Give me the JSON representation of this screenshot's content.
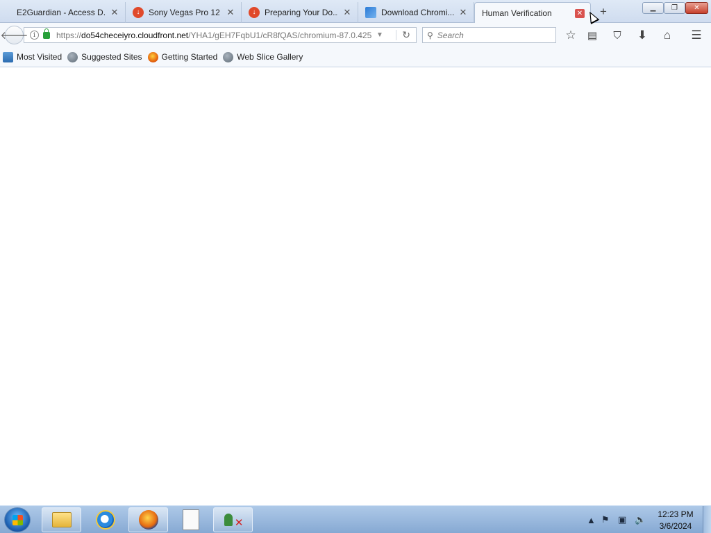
{
  "browser": {
    "tabs": [
      {
        "label": "E2Guardian - Access D...",
        "favicon": "none",
        "active": false
      },
      {
        "label": "Sony Vegas Pro 12 ...",
        "favicon": "download-icon",
        "active": false
      },
      {
        "label": "Preparing Your Do...",
        "favicon": "download-icon",
        "active": false
      },
      {
        "label": "Download Chromi...",
        "favicon": "chromium-icon",
        "active": false
      },
      {
        "label": "Human Verification",
        "favicon": "none",
        "active": true
      }
    ],
    "new_tab_glyph": "+",
    "url": {
      "scheme": "https://",
      "host": "do54checeiyro.cloudfront.net",
      "path": "/YHA1/gEH7FqbU1/cR8fQAS/chromium-87.0.425"
    },
    "search": {
      "placeholder": "Search"
    }
  },
  "bookmarks": [
    {
      "label": "Most Visited",
      "icon": "most-visited-icon"
    },
    {
      "label": "Suggested Sites",
      "icon": "globe-icon"
    },
    {
      "label": "Getting Started",
      "icon": "firefox-icon"
    },
    {
      "label": "Web Slice Gallery",
      "icon": "globe-icon"
    }
  ],
  "taskbar": {
    "apps": [
      "explorer",
      "internet-explorer",
      "firefox",
      "file",
      "network"
    ],
    "clock": {
      "time": "12:23 PM",
      "date": "3/6/2024"
    }
  },
  "colors": {
    "accent": "#cfdcef",
    "tab_close_highlight": "#d9534f",
    "lock": "#27a039"
  }
}
